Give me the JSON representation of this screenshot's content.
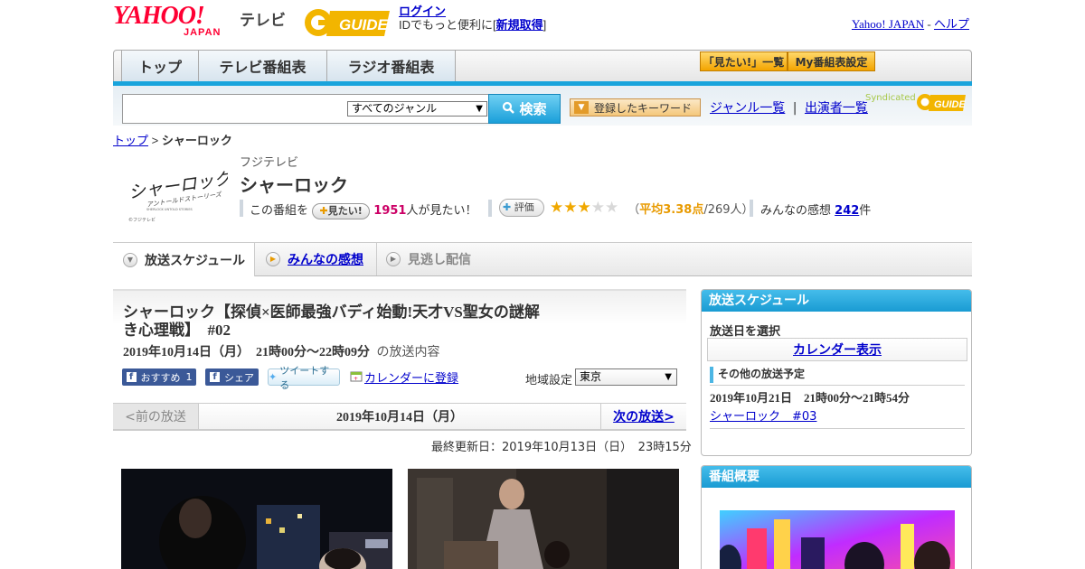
{
  "header": {
    "yahoo_logo": "YAHOO!",
    "yahoo_sub": "JAPAN",
    "tv_label": "テレビ",
    "gguide_logo": "G-GUIDE",
    "login_link": "ログイン",
    "login_text": "IDでもっと便利に[",
    "register_link": "新規取得",
    "register_close": "]",
    "yahoo_japan_link": "Yahoo! JAPAN",
    "dash": " - ",
    "help_link": "ヘルプ"
  },
  "nav": {
    "tabs": [
      "トップ",
      "テレビ番組表",
      "ラジオ番組表"
    ],
    "mitai_list": "「見たい!」一覧",
    "my_schedule": "My番組表設定"
  },
  "search": {
    "genre": "すべてのジャンル",
    "button": "検索",
    "keyword_button": "登録したキーワード",
    "genre_list": "ジャンル一覧",
    "divider": "|",
    "cast_list": "出演者一覧",
    "syndicated": "Syndicated"
  },
  "breadcrumb": {
    "top": "トップ",
    "sep": " > ",
    "current": "シャーロック"
  },
  "program": {
    "logo_text": "シャーロック",
    "logo_sub": "アントールドストーリーズ",
    "logo_en": "SHERLOCK UNTOLD STORIES",
    "logo_copy": "©フジテレビ",
    "station": "フジテレビ",
    "title": "シャーロック",
    "mitai_prefix": "この番組を",
    "mitai_button": "見たい!",
    "mitai_count": "1951",
    "mitai_suffix": "人が見たい！",
    "hyoka_button": "評価",
    "rating": 3.38,
    "rating_open": "（",
    "rating_avg_label": "平均3.38点",
    "rating_count": "/269人）",
    "kanso_label": "みんなの感想",
    "kanso_count": "242",
    "kanso_unit": "件"
  },
  "tabs": {
    "schedule": "放送スケジュール",
    "kanso": "みんなの感想",
    "minogashi": "見逃し配信"
  },
  "episode": {
    "title": "シャーロック【探偵×医師最強バディ始動!天才VS聖女の謎解き心理戦】　#02",
    "date": "2019年10月14日（月）　21時00分～22時09分",
    "date_suffix": "の放送内容",
    "osusume": "おすすめ",
    "osusume_count": "1",
    "share": "シェア",
    "tweet": "ツイートする",
    "calendar_register": "カレンダーに登録",
    "region_label": "地域設定",
    "region": "東京"
  },
  "pager": {
    "prev": "<前の放送",
    "current": "2019年10月14日（月）",
    "next": "次の放送>"
  },
  "updated": "最終更新日：2019年10月13日（日）　23時15分",
  "sidebar": {
    "schedule_head": "放送スケジュール",
    "select_date": "放送日を選択",
    "calendar_button": "カレンダー表示",
    "other_head": "その他の放送予定",
    "other_date": "2019年10月21日　21時00分～21時54分",
    "other_link": "シャーロック　#03",
    "overview_head": "番組概要"
  },
  "colors": {
    "accent_blue": "#19a4dc",
    "yahoo_red": "#ff0033",
    "star_gold": "#f0a800",
    "mitai_pink": "#cc0066"
  }
}
